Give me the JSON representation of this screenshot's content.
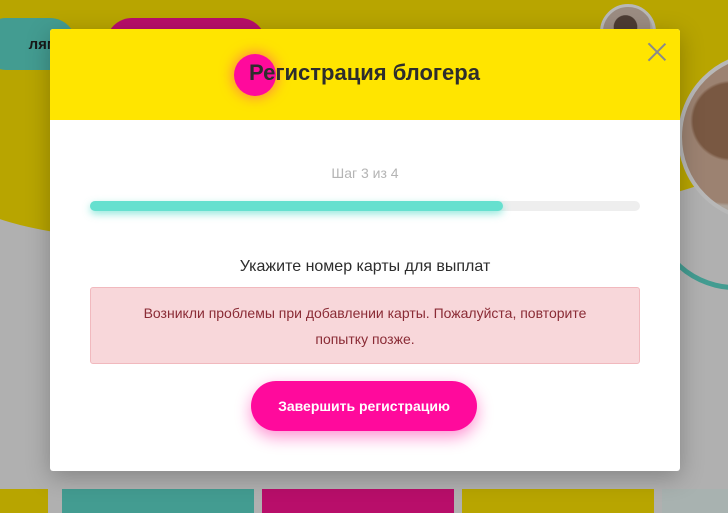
{
  "background": {
    "nav_pill_label": "лям"
  },
  "modal": {
    "title": "Регистрация блогера",
    "step_text": "Шаг 3 из 4",
    "progress_fraction": 0.75,
    "section_label": "Укажите номер карты для выплат",
    "error_message": "Возникли проблемы при добавлении карты. Пожалуйста, повторите попытку позже.",
    "submit_label": "Завершить регистрацию"
  },
  "colors": {
    "accent_pink": "#ff0a9c",
    "header_yellow": "#ffe500",
    "progress_teal": "#66e0cf",
    "error_bg": "#f8d7da",
    "error_text": "#8a2b35"
  },
  "icons": {
    "close": "close-icon"
  }
}
